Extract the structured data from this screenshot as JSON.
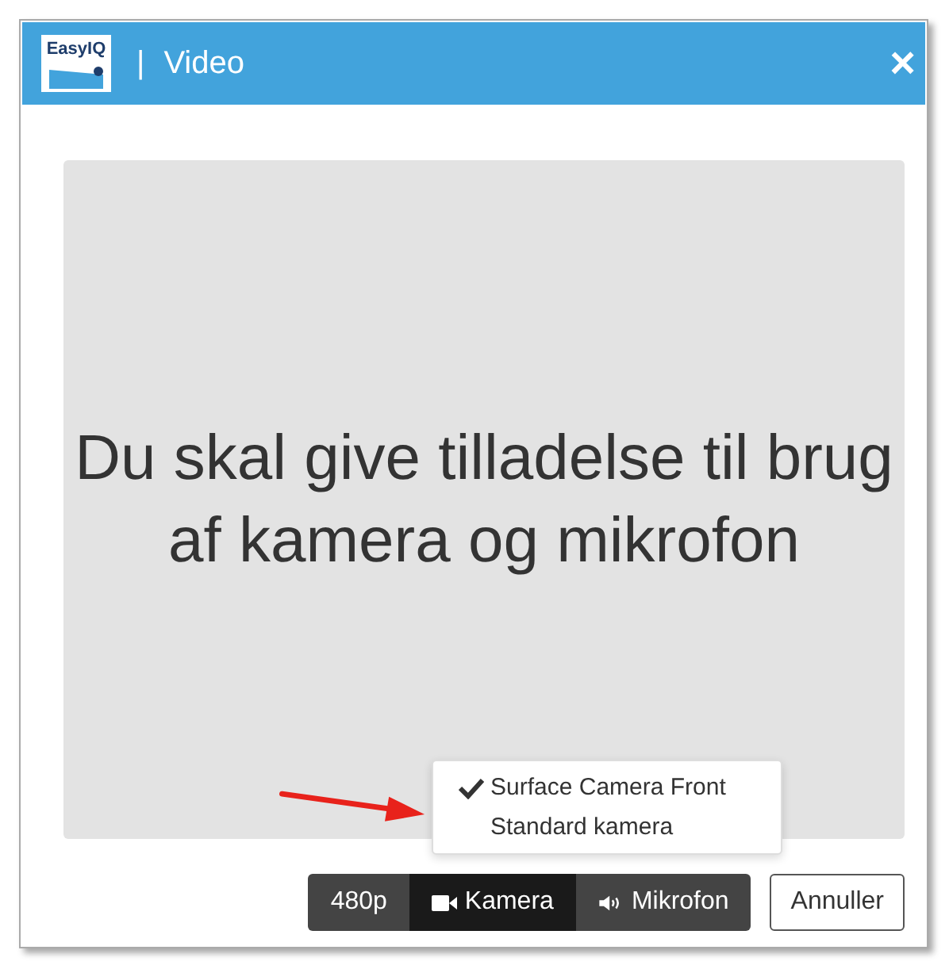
{
  "window": {
    "logo": "EasyIQ",
    "separator": "|",
    "title": "Video",
    "close": "×"
  },
  "video": {
    "message": "Du skal give tilladelse til brug af kamera og mikrofon"
  },
  "camera_menu": {
    "items": [
      {
        "label": "Surface Camera Front",
        "checked": true
      },
      {
        "label": "Standard kamera",
        "checked": false
      }
    ]
  },
  "toolbar": {
    "buttons": [
      {
        "kind": "text",
        "label": "480p",
        "selected": false
      },
      {
        "kind": "camera",
        "label": "Kamera",
        "selected": true
      },
      {
        "kind": "mic",
        "label": "Mikrofon",
        "selected": false
      }
    ]
  },
  "cancel": "Annuller"
}
